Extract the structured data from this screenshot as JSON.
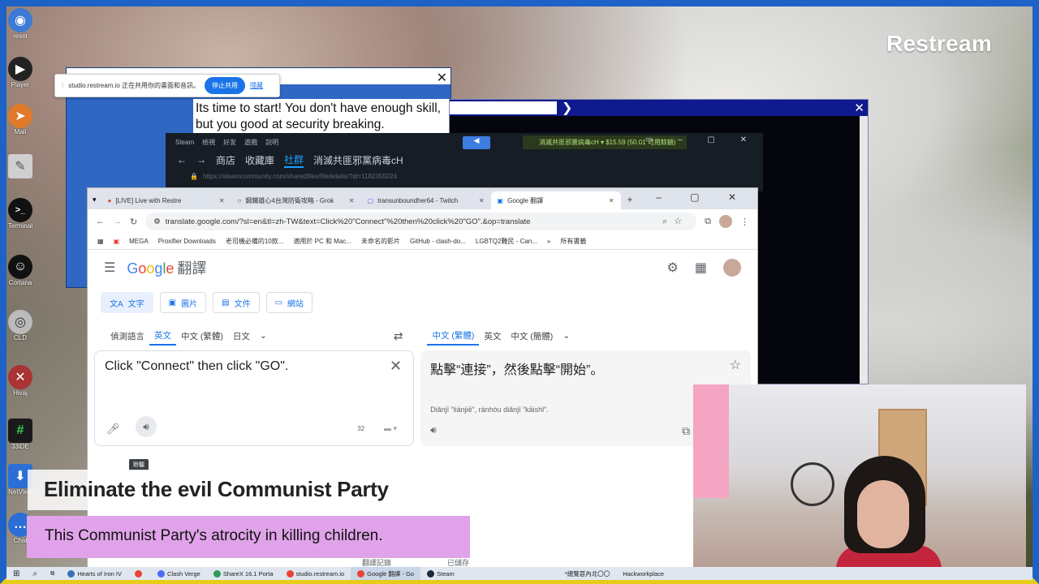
{
  "overlay": {
    "brand": "Restream",
    "caption_title": "Eliminate the evil Communist Party",
    "caption_subtitle": "This  Communist Party's atrocity in killing children."
  },
  "desktop_icons": [
    {
      "label": "reset",
      "icon": "globe-icon",
      "color": "#3b7bd6"
    },
    {
      "label": "Player",
      "icon": "player-icon",
      "color": "#222222"
    },
    {
      "label": "Mail",
      "icon": "paper-plane-icon",
      "color": "#e07a2a"
    },
    {
      "label": "",
      "icon": "notepad-icon",
      "color": "#cfcfcf"
    },
    {
      "label": "Terminal",
      "icon": "terminal-icon",
      "color": "#111111"
    },
    {
      "label": "Cortana",
      "icon": "person-icon",
      "color": "#111111"
    },
    {
      "label": "CLD",
      "icon": "disk-icon",
      "color": "#bbbbbb"
    },
    {
      "label": "Hivaj",
      "icon": "tool-icon",
      "color": "#a33"
    },
    {
      "label": "33iDE",
      "icon": "hash-icon",
      "color": "#1a1a1a"
    },
    {
      "label": "NetView",
      "icon": "download-icon",
      "color": "#2b6fd6"
    },
    {
      "label": "Chat",
      "icon": "chat-icon",
      "color": "#2b6fd6"
    }
  ],
  "share_bar": {
    "text": "studio.restream.io 正在共用你的畫面和音訊。",
    "stop_label": "停止共用",
    "hide_label": "隱藏"
  },
  "blue_window": {
    "message": "Its time to start! You don't have enough skill, but you good at security breaking."
  },
  "steam": {
    "menu": [
      "Steam",
      "檢視",
      "好友",
      "遊戲",
      "說明"
    ],
    "nav": [
      "商店",
      "收藏庫",
      "社群",
      "消滅共匪邪黨病毒cH"
    ],
    "active_nav": "社群",
    "url": "https://steamcommunity.com/sharedfiles/filedetails/?id=1182355024",
    "user_status": "消滅共匪邪黨病毒cH ▾  $15.59 (50.01 可用餘額)"
  },
  "chrome": {
    "tabs": [
      {
        "title": "[LIVE] Live with Restre",
        "active": false
      },
      {
        "title": "鋼鐵雄心4台灣防衛攻略 - Grok",
        "active": false
      },
      {
        "title": "transunboundher64 - Twitch",
        "active": false
      },
      {
        "title": "Google 翻譯",
        "active": true
      }
    ],
    "address": "translate.google.com/?sl=en&tl=zh-TW&text=Click%20\"Connect\"%20then%20click%20\"GO\".&op=translate",
    "bookmarks": [
      "MEGA",
      "Proxifier Downloads",
      "老司機必備的10款...",
      "適用於 PC 和 Mac...",
      "未命名的影片",
      "GitHub - clash-do...",
      "LGBTQ2難民 - Can...",
      "所有書籤"
    ]
  },
  "translate": {
    "logo_suffix": "翻譯",
    "modes": [
      "文字",
      "圖片",
      "文件",
      "網站"
    ],
    "source_langs": [
      "偵測語言",
      "英文",
      "中文 (繁體)",
      "日文"
    ],
    "source_selected": "英文",
    "target_langs": [
      "中文 (繁體)",
      "英文",
      "中文 (簡體)"
    ],
    "target_selected": "中文 (繁體)",
    "source_text": "Click \"Connect\" then click \"GO\".",
    "char_count": "32",
    "tooltip": "聆聽",
    "target_text": "點擊“連接”，然後點擊“開始”。",
    "romanization": "Diǎnjī “liánjiē”, ránhòu diǎnjī “kāishǐ”.",
    "history_label": "翻譯記錄",
    "saved_label": "已儲存"
  },
  "taskbar": [
    {
      "label": "Hearts of Iron IV",
      "color": "#3b6fb6"
    },
    {
      "label": "",
      "color": "#ea4335"
    },
    {
      "label": "Clash Verge",
      "color": "#4a6cf7"
    },
    {
      "label": "ShareX 16.1 Porta",
      "color": "#2d9b5a"
    },
    {
      "label": "studio.restream.io",
      "color": "#ea4335"
    },
    {
      "label": "Google 翻譯 - Go",
      "color": "#ea4335"
    },
    {
      "label": "Steam",
      "color": "#1b2838"
    },
    {
      "label": "*總覽甚內北〇〇",
      "color": "#666666"
    },
    {
      "label": "Hackworkplace",
      "color": "#999999"
    }
  ]
}
